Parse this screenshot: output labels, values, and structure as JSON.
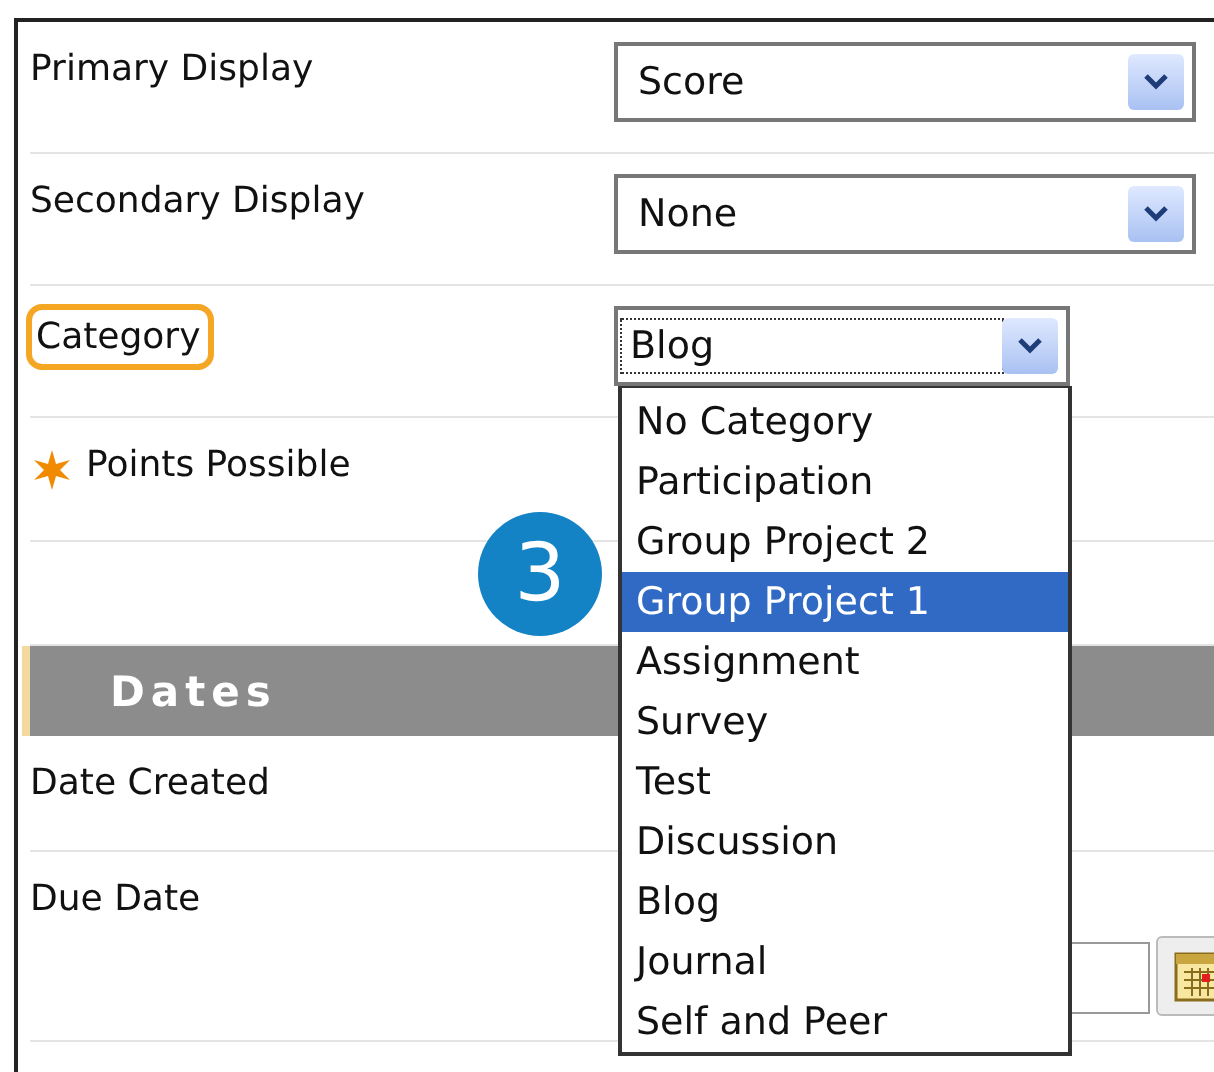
{
  "fields": [
    {
      "label": "Primary Display",
      "kind": "select",
      "value": "Score",
      "highlighted": false,
      "required": false
    },
    {
      "label": "Secondary Display",
      "kind": "select",
      "value": "None",
      "highlighted": false,
      "required": false
    },
    {
      "label": "Category",
      "kind": "select-open",
      "value": "Blog",
      "highlighted": true,
      "required": false
    },
    {
      "label": "Points Possible",
      "kind": "text",
      "highlighted": false,
      "required": true
    },
    {
      "kind": "blank"
    }
  ],
  "step_badge": "3",
  "dates_section": {
    "title": "Dates",
    "fields": [
      {
        "label": "Date Created",
        "kind": "text"
      },
      {
        "label": "Due Date",
        "kind": "date"
      }
    ]
  },
  "category_options": [
    {
      "label": "No Category",
      "selected": false
    },
    {
      "label": "Participation",
      "selected": false
    },
    {
      "label": "Group Project 2",
      "selected": false
    },
    {
      "label": "Group Project 1",
      "selected": true
    },
    {
      "label": "Assignment",
      "selected": false
    },
    {
      "label": "Survey",
      "selected": false
    },
    {
      "label": "Test",
      "selected": false
    },
    {
      "label": "Discussion",
      "selected": false
    },
    {
      "label": "Blog",
      "selected": false
    },
    {
      "label": "Journal",
      "selected": false
    },
    {
      "label": "Self and Peer",
      "selected": false
    }
  ]
}
